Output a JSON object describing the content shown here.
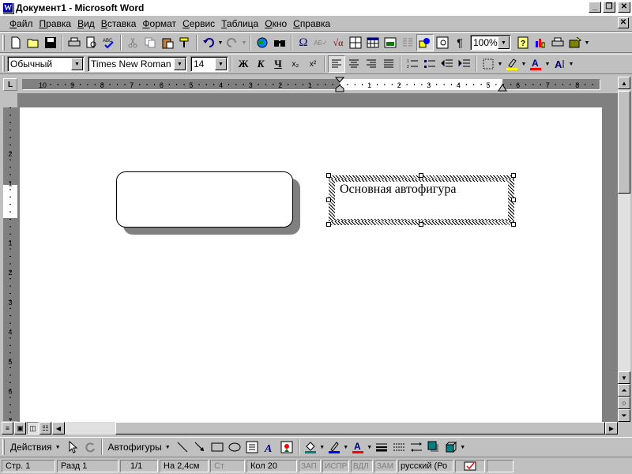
{
  "window": {
    "title": "Документ1 - Microsoft Word",
    "app_icon_letter": "W"
  },
  "menu": {
    "items": [
      "Файл",
      "Правка",
      "Вид",
      "Вставка",
      "Формат",
      "Сервис",
      "Таблица",
      "Окно",
      "Справка"
    ]
  },
  "standard_toolbar": {
    "zoom": "100%",
    "icons": [
      "new-icon",
      "open-icon",
      "save-icon",
      "print-icon",
      "print-preview-icon",
      "spelling-icon",
      "cut-icon",
      "copy-icon",
      "paste-icon",
      "format-painter-icon",
      "undo-icon",
      "redo-icon",
      "web-toolbar-icon",
      "find-icon",
      "symbol-icon",
      "spelling-abc-icon",
      "equation-icon",
      "insert-table-icon",
      "table-icon",
      "excel-icon",
      "columns-icon",
      "drawing-icon",
      "document-map-icon",
      "pilcrow-icon",
      "help-icon",
      "chart-icon",
      "print-icon-2",
      "briefcase-icon"
    ]
  },
  "format_toolbar": {
    "style": "Обычный",
    "font": "Times New Roman",
    "size": "14",
    "bold": "Ж",
    "italic": "К",
    "underline": "Ч",
    "subscript": "x₂",
    "superscript": "x²",
    "highlight_color": "#ffff00",
    "font_color": "#ff0000"
  },
  "ruler": {
    "box": "L",
    "h_labels": [
      "10",
      "9",
      "8",
      "7",
      "6",
      "5",
      "4",
      "3",
      "2",
      "1",
      "1",
      "2",
      "3",
      "4",
      "5",
      "6",
      "7",
      "8",
      "9"
    ],
    "v_labels": [
      "2",
      "1",
      "1",
      "2",
      "3",
      "4",
      "5",
      "6",
      "7"
    ]
  },
  "document": {
    "textbox_text": "Основная автофигура"
  },
  "draw_toolbar": {
    "actions": "Действия",
    "autoshapes": "Автофигуры",
    "line_color": "#0000ff",
    "font_color": "#ff0000",
    "fill_color": "#008080"
  },
  "status": {
    "page": "Стр. 1",
    "section": "Разд 1",
    "pages": "1/1",
    "at": "На 2,4см",
    "line": "Ст",
    "col": "Кол 20",
    "rec": "ЗАП",
    "trk": "ИСПР",
    "ext": "ВДЛ",
    "ovr": "ЗАМ",
    "lang": "русский (Ро"
  }
}
